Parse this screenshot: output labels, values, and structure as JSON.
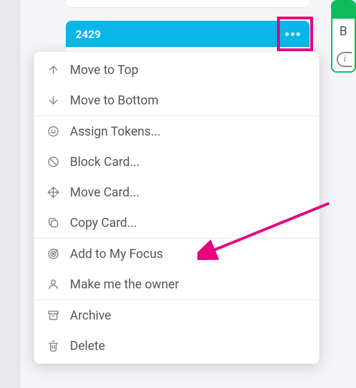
{
  "card": {
    "id": "2429"
  },
  "rightCard": {
    "letter": "B"
  },
  "menu": {
    "moveTop": "Move to Top",
    "moveBottom": "Move to Bottom",
    "assignTokens": "Assign Tokens...",
    "blockCard": "Block Card...",
    "moveCard": "Move Card...",
    "copyCard": "Copy Card...",
    "addFocus": "Add to My Focus",
    "makeOwner": "Make me the owner",
    "archive": "Archive",
    "delete": "Delete"
  }
}
